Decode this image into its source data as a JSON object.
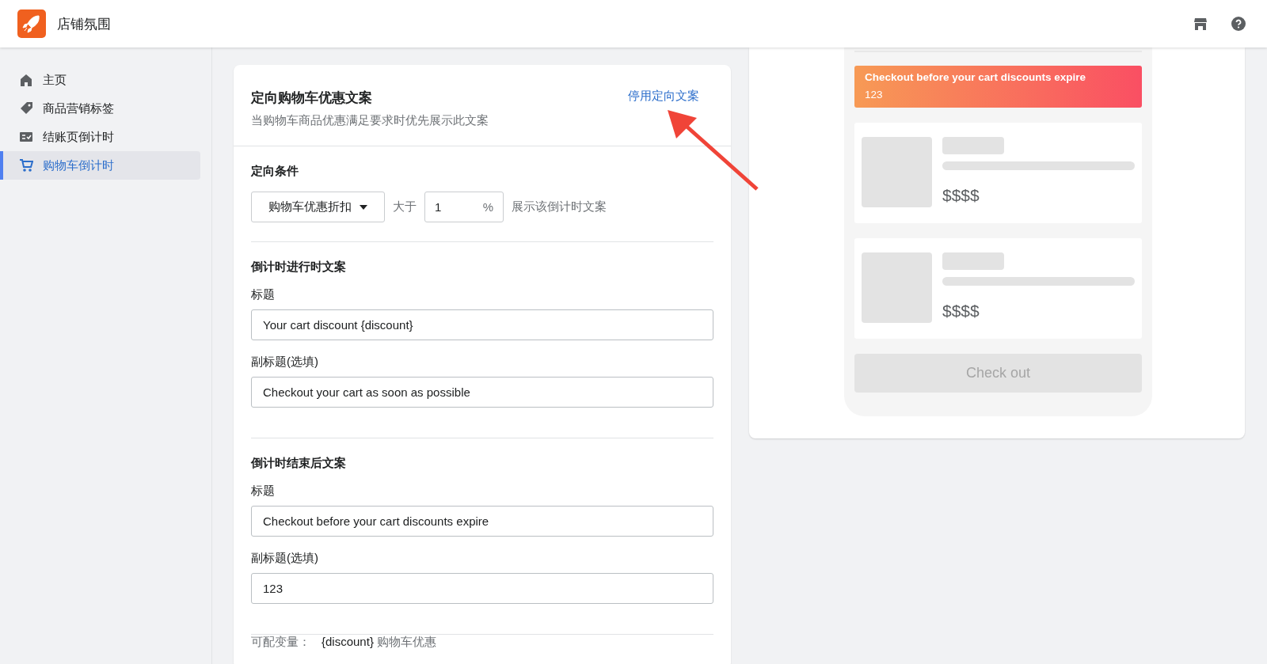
{
  "app": {
    "title": "店铺氛围"
  },
  "sidebar": {
    "items": [
      {
        "label": "主页",
        "kind": "home",
        "selected": false
      },
      {
        "label": "商品营销标签",
        "kind": "tag",
        "selected": false
      },
      {
        "label": "结账页倒计时",
        "kind": "checklist",
        "selected": false
      },
      {
        "label": "购物车倒计时",
        "kind": "cart",
        "selected": true
      }
    ]
  },
  "targeted": {
    "title": "定向购物车优惠文案",
    "action_link": "停用定向文案",
    "description": "当购物车商品优惠满足要求时优先展示此文案",
    "condition": {
      "heading": "定向条件",
      "select": "购物车优惠折扣",
      "before": "大于",
      "value": "1",
      "unit": "%",
      "after": "展示该倒计时文案"
    },
    "sections": [
      {
        "heading": "倒计时进行时文案",
        "fields": [
          {
            "label": "标题",
            "value": "Your cart discount {discount}"
          },
          {
            "label": "副标题(选填)",
            "value": "Checkout your cart as soon as possible"
          }
        ]
      },
      {
        "heading": "倒计时结束后文案",
        "fields": [
          {
            "label": "标题",
            "value": "Checkout before your cart discounts expire"
          },
          {
            "label": "副标题(选填)",
            "value": "123"
          }
        ]
      }
    ],
    "variables": {
      "label": "可配变量：",
      "name": "{discount}",
      "description": "购物车优惠"
    }
  },
  "preview": {
    "banner": {
      "title": "Checkout before your cart discounts expire",
      "subtitle": "123"
    },
    "items": [
      {
        "price": "$$$$"
      },
      {
        "price": "$$$$"
      }
    ],
    "button": {
      "label": "Check out",
      "disabled": true
    }
  }
}
